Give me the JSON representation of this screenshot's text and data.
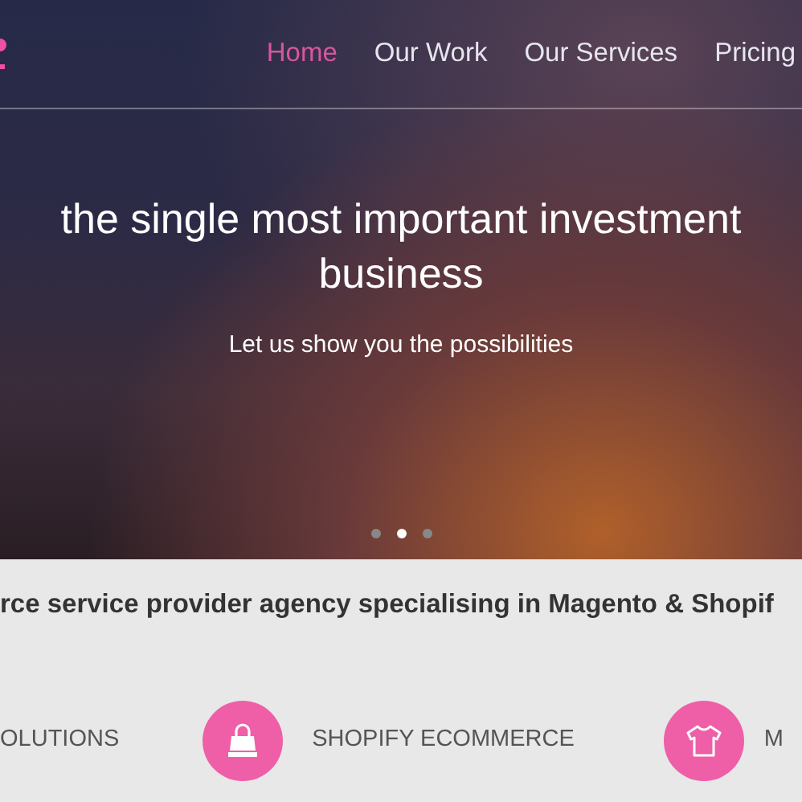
{
  "nav": {
    "items": [
      {
        "label": "Home",
        "selected": true
      },
      {
        "label": "Our Work",
        "selected": false
      },
      {
        "label": "Our Services",
        "selected": false
      },
      {
        "label": "Pricing",
        "selected": false
      }
    ]
  },
  "hero": {
    "title_lines": [
      "the single most important investment",
      "business"
    ],
    "subtitle": "Let us show you the possibilities",
    "slides": [
      {
        "selected": false
      },
      {
        "selected": true
      },
      {
        "selected": false
      }
    ]
  },
  "tagline": "rce service provider agency specialising in Magento & Shopif",
  "services": [
    {
      "kind": "text",
      "label": "OLUTIONS"
    },
    {
      "kind": "bag",
      "label": "SHOPIFY ECOMMERCE"
    },
    {
      "kind": "shirt",
      "label": "M"
    }
  ]
}
